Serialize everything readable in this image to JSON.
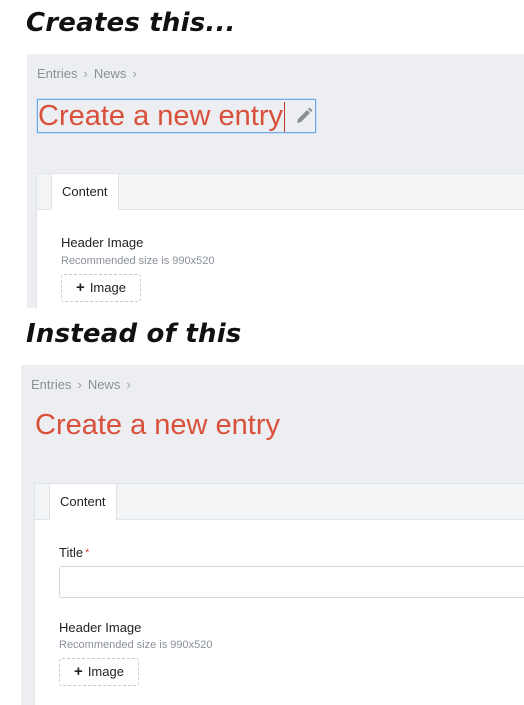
{
  "captions": {
    "first": "Creates this...",
    "second": "Instead of this"
  },
  "breadcrumb": {
    "items": [
      "Entries",
      "News"
    ],
    "separator": "›"
  },
  "page": {
    "title": "Create a new entry"
  },
  "tabs": {
    "content": "Content"
  },
  "fields": {
    "title_label": "Title",
    "title_required_marker": "*",
    "title_value": "",
    "header_image_label": "Header Image",
    "header_image_help": "Recommended size is 990x520",
    "image_button_label": "Image"
  },
  "colors": {
    "title": "#d9503b",
    "focus_border": "#6ea7e8",
    "background": "#eceef1",
    "required": "#e04b3b"
  }
}
